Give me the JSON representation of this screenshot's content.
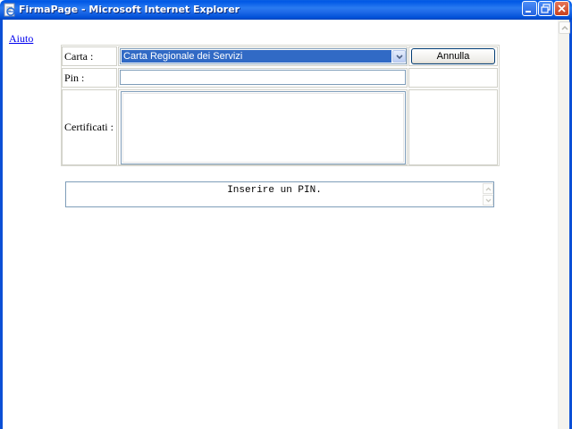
{
  "window": {
    "title": "FirmaPage - Microsoft Internet Explorer",
    "icon": "ie-page-icon"
  },
  "page": {
    "help_link": "Aiuto",
    "form": {
      "card_label": "Carta :",
      "card_selected": "Carta Regionale dei Servizi",
      "cancel_button": "Annulla",
      "pin_label": "Pin :",
      "pin_value": "",
      "certificates_label": "Certificati :",
      "certificates_value": ""
    },
    "message": "Inserire un PIN."
  }
}
